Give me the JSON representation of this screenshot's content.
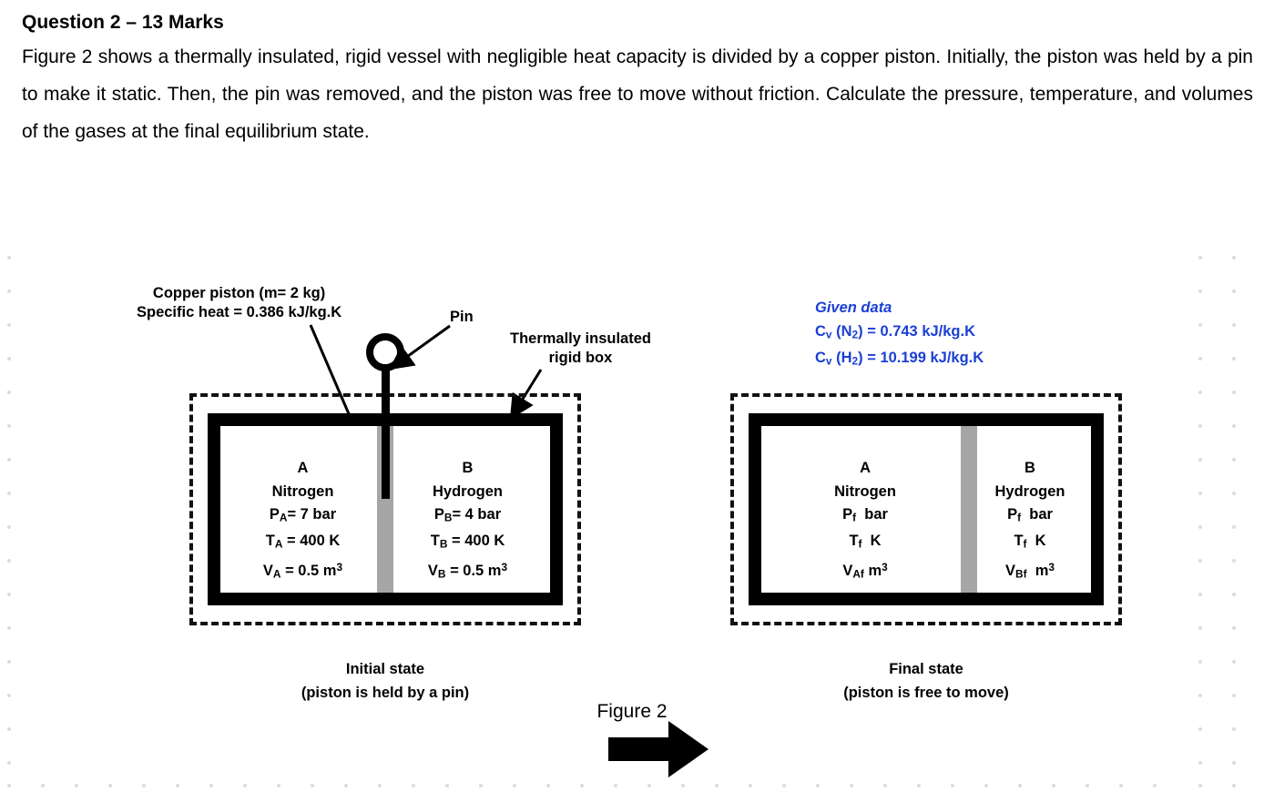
{
  "question": {
    "heading": "Question 2 – 13 Marks",
    "body": "Figure 2 shows a thermally insulated, rigid vessel with negligible heat capacity is divided by a copper piston. Initially, the piston was held by a pin to make it static. Then, the pin was removed, and the piston was free to move without friction. Calculate the pressure, temperature, and volumes of the gases at the final equilibrium state."
  },
  "figure": {
    "caption": "Figure 2",
    "callouts": {
      "piston_line1": "Copper piston (m= 2 kg)",
      "piston_line2": "Specific heat = 0.386 kJ/kg.K",
      "pin": "Pin",
      "box_line1": "Thermally insulated",
      "box_line2": "rigid box"
    },
    "given_data": {
      "title": "Given data",
      "lines": [
        "Cv (N2) = 0.743 kJ/kg.K",
        "Cv (H2) = 10.199 kJ/kg.K"
      ],
      "color": "#1b3fd4"
    },
    "initial_state": {
      "caption_line1": "Initial state",
      "caption_line2": "(piston is held by a pin)",
      "left_chamber": {
        "id": "A",
        "gas": "Nitrogen",
        "pressure": "PA= 7 bar",
        "temperature": "TA = 400 K",
        "volume": "VA = 0.5 m3"
      },
      "right_chamber": {
        "id": "B",
        "gas": "Hydrogen",
        "pressure": "PB= 4 bar",
        "temperature": "TB = 400 K",
        "volume": "VB = 0.5 m3"
      }
    },
    "final_state": {
      "caption_line1": "Final state",
      "caption_line2": "(piston is free to move)",
      "left_chamber": {
        "id": "A",
        "gas": "Nitrogen",
        "pressure": "Pf  bar",
        "temperature": "Tf  K",
        "volume": "VAf m3"
      },
      "right_chamber": {
        "id": "B",
        "gas": "Hydrogen",
        "pressure": "Pf  bar",
        "temperature": "Tf  K",
        "volume": "VBf  m3"
      }
    },
    "transition_arrow": "right-arrow"
  }
}
